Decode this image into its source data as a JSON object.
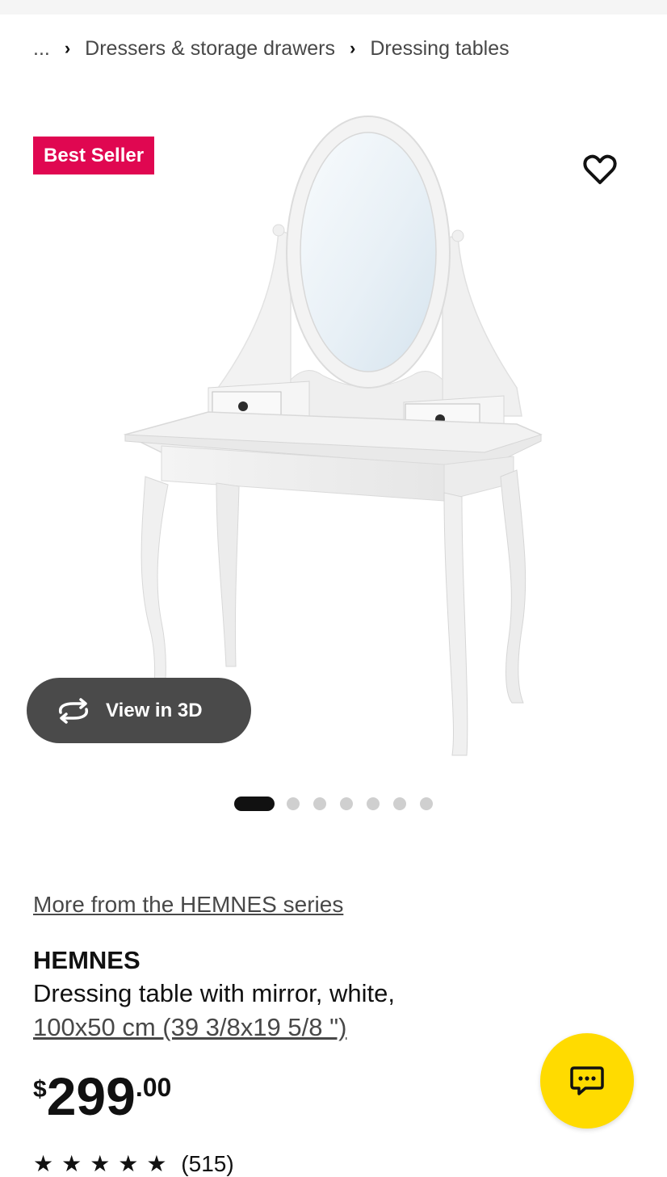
{
  "breadcrumb": {
    "ellipsis": "...",
    "items": [
      "Dressers & storage drawers",
      "Dressing tables"
    ]
  },
  "gallery": {
    "badge": "Best Seller",
    "view3d_label": "View in 3D",
    "dots_total": 7,
    "dots_active_index": 0
  },
  "product": {
    "series_link": "More from the HEMNES series",
    "name": "HEMNES",
    "description": "Dressing table with mirror, white,",
    "size": "100x50 cm (39 3/8x19 5/8 \")",
    "price": {
      "currency": "$",
      "integer": "299",
      "decimal": ".00"
    },
    "rating": {
      "stars": "★★★★★",
      "count": "(515)"
    }
  },
  "colors": {
    "badge": "#e00751",
    "chat_button": "#ffdb00",
    "view3d_bg": "#4a4a4a"
  },
  "icons": {
    "favorite": "heart-icon",
    "view3d": "rotate-3d-icon",
    "chat": "chat-icon"
  }
}
